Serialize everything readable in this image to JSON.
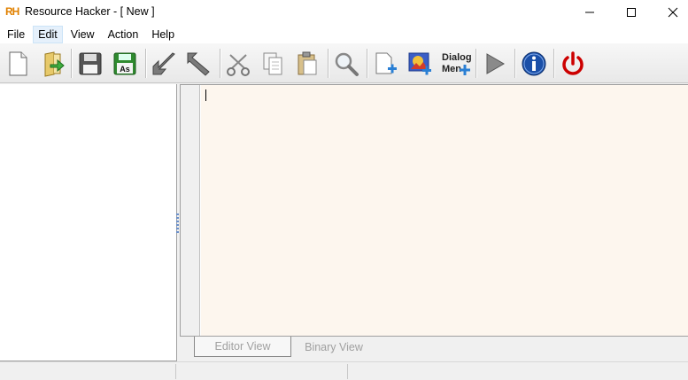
{
  "window": {
    "logo_text": "RH",
    "title": "Resource Hacker - [ New ]"
  },
  "menu": [
    {
      "label": "File"
    },
    {
      "label": "Edit"
    },
    {
      "label": "Action"
    },
    {
      "label": "View"
    },
    {
      "label": "Help"
    }
  ],
  "menu_order": [
    "File",
    "Edit",
    "View",
    "Action",
    "Help"
  ],
  "menubar": {
    "file": "File",
    "edit": "Edit",
    "view": "View",
    "action": "Action",
    "help": "Help"
  },
  "toolbar": {
    "dialog_label_line1": "Dialog",
    "dialog_label_line2": "Men",
    "icons": [
      "new-file-icon",
      "open-file-icon",
      "save-icon",
      "save-as-icon",
      "compile-icon",
      "run-script-icon",
      "cut-icon",
      "copy-icon",
      "paste-icon",
      "find-icon",
      "add-resource-icon",
      "add-image-icon",
      "dialog-menu-icon",
      "play-icon",
      "info-icon",
      "power-icon"
    ],
    "save_as_text": "As"
  },
  "tabs": {
    "editor_view": "Editor View",
    "binary_view": "Binary View"
  },
  "colors": {
    "editor_bg": "#fdf6ee",
    "active_menu_bg": "#e5f0fb",
    "close_red": "#cc0000",
    "info_blue": "#1a4fa8",
    "save_green": "#2f8a2f"
  }
}
